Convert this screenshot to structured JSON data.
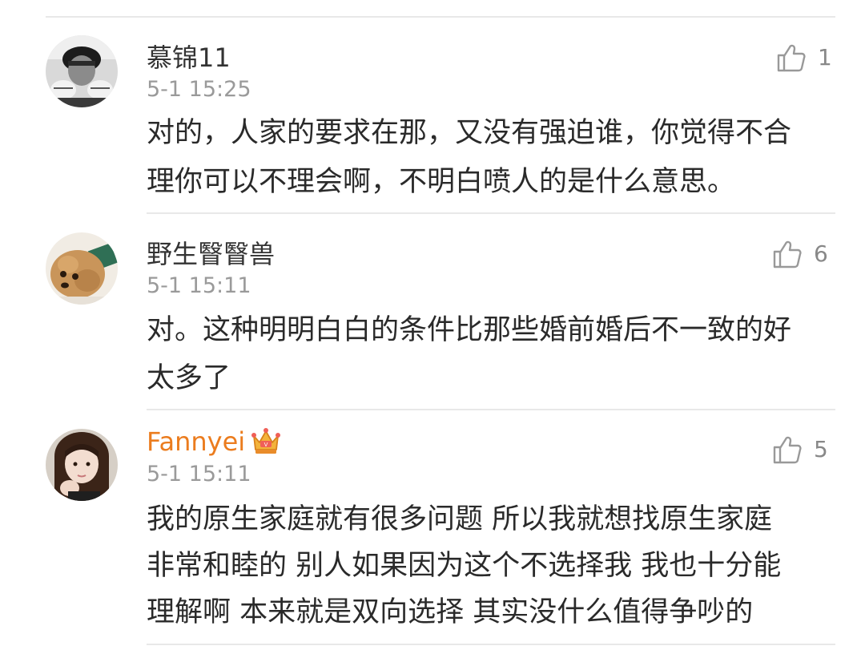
{
  "comments": [
    {
      "username": "慕锦11",
      "time": "5-1 15:25",
      "likes": "1",
      "lines": [
        "对的，人家的要求在那，又没有强迫谁，你觉得不合",
        "理你可以不理会啊，不明白喷人的是什么意思。"
      ]
    },
    {
      "username": "野生瞖瞖兽",
      "time": "5-1 15:11",
      "likes": "6",
      "lines": [
        "对。这种明明白白的条件比那些婚前婚后不一致的好",
        "太多了"
      ]
    },
    {
      "username": "Fannyei",
      "time": "5-1 15:11",
      "likes": "5",
      "badge": "vip-crown-icon",
      "lines": [
        "我的原生家庭就有很多问题 所以我就想找原生家庭",
        "非常和睦的 别人如果因为这个不选择我 我也十分能",
        "理解啊 本来就是双向选择 其实没什么值得争吵的"
      ]
    }
  ],
  "colors": {
    "username": "#333333",
    "vip_username": "#eb7c1e",
    "timestamp": "#9a9a9a",
    "like_count": "#888888",
    "divider": "#e8e8e8"
  }
}
